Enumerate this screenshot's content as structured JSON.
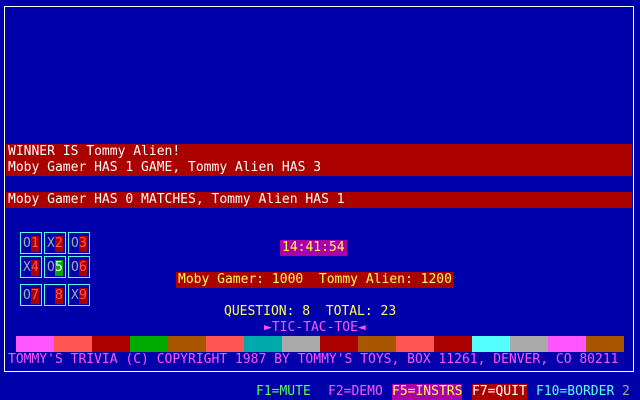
{
  "winner_line": "WINNER IS Tommy Alien!",
  "game_line": "Moby Gamer HAS 1 GAME, Tommy Alien HAS 3",
  "match_line": "Moby Gamer HAS 0 MATCHES, Tommy Alien HAS 1",
  "clock": "14:41:54",
  "scores": "Moby Gamer: 1000  Tommy Alien: 1200",
  "question_line": "QUESTION: 8  TOTAL: 23",
  "game_title": "TIC-TAC-TOE",
  "copyright": "TOMMY'S TRIVIA (C) COPYRIGHT 1987 BY TOMMY'S TOYS, BOX 11261, DENVER, CO 80211",
  "board": [
    {
      "mark": "O",
      "num": "1",
      "pad": "#ff5555",
      "num_bg": "#aa0000"
    },
    {
      "mark": "X",
      "num": "2",
      "pad": "#aaaaaa",
      "num_bg": "#aa0000"
    },
    {
      "mark": "O",
      "num": "3",
      "pad": "#00aa00",
      "num_bg": "#aa0000"
    },
    {
      "mark": "X",
      "num": "4",
      "pad": "#aaaaaa",
      "num_bg": "#aa0000"
    },
    {
      "mark": "O",
      "num": "5",
      "pad": "#00aa00",
      "num_bg": "#00aa00"
    },
    {
      "mark": "O",
      "num": "6",
      "pad": "#aaaaaa",
      "num_bg": "#aa0000"
    },
    {
      "mark": "O",
      "num": "7",
      "pad": "#00aa00",
      "num_bg": "#aa0000"
    },
    {
      "mark": "",
      "num": "8",
      "pad": "#ff5555",
      "num_bg": "#aa0000"
    },
    {
      "mark": "X",
      "num": "9",
      "pad": "#aaaaaa",
      "num_bg": "#aa0000"
    }
  ],
  "stripes": [
    "#ff55ff",
    "#ff5555",
    "#aa0000",
    "#00aa00",
    "#aa5500",
    "#ff5555",
    "#00aaaa",
    "#aaaaaa",
    "#aa0000",
    "#aa5500",
    "#ff5555",
    "#aa0000",
    "#55ffff",
    "#aaaaaa",
    "#ff55ff",
    "#aa5500"
  ],
  "function_keys": [
    {
      "label": "F1=MUTE",
      "color": "#55ff55",
      "bg": ""
    },
    {
      "label": "F2=DEMO",
      "color": "#ff55ff",
      "bg": ""
    },
    {
      "label": "F5=INSTRS",
      "color": "#ffff55",
      "bg": "#aa00aa"
    },
    {
      "label": "F7=QUIT",
      "color": "#ffffff",
      "bg": "#aa0000"
    },
    {
      "label": "F10=BORDER",
      "color": "#55ffff",
      "bg": ""
    }
  ],
  "border_value": "2",
  "colors": {
    "background": "#0000aa",
    "bar": "#aa0000",
    "clock_bg": "#aa00aa"
  }
}
